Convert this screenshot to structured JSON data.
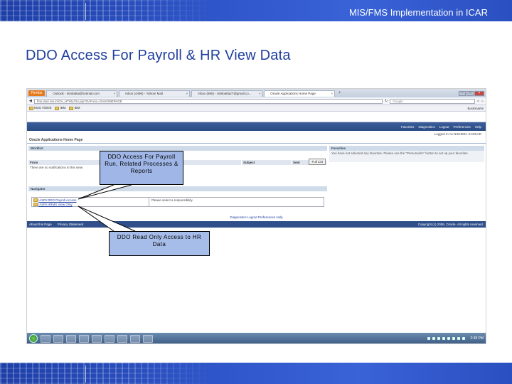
{
  "slide": {
    "header": "MIS/FMS Implementation in ICAR",
    "title": "DDO Access For Payroll & HR View Data"
  },
  "browser": {
    "firefox_label": "Firefox",
    "tabs": [
      {
        "label": "Outlook - ntinbatta@hotmail.com",
        "active": false
      },
      {
        "label": "Inbox (4496) - Yahoo! Mail",
        "active": false
      },
      {
        "label": "Inbox (865) - nitinbatta27@gmail.co...",
        "active": false
      },
      {
        "label": "Oracle Applications Home Page",
        "active": true
      }
    ],
    "url": "fms.iasri.res.in/OA_HTML/OA.jsp?OAFunc=OAHOMEPAGE",
    "search_placeholder": "Google",
    "bookmarks": {
      "items": [
        "Most Visited",
        "IBM",
        "IBM"
      ],
      "right": "Bookmarks"
    }
  },
  "oracle": {
    "global_links": [
      "Favorites",
      "Diagnostics",
      "Logout",
      "Preferences",
      "Help"
    ],
    "logged_in": "Logged In As NISHEEL SARKAR",
    "page_title": "Oracle Applications Home Page",
    "worklist": {
      "header": "Worklist",
      "full_list_button": "Full List",
      "columns": [
        "From",
        "Type",
        "Subject",
        "Sent"
      ],
      "empty_message": "There are no notifications in this view."
    },
    "favorites": {
      "header": "Favorites",
      "message": "You have not selected any favorites. Please use the \"Personalize\" button to set up your favorites."
    },
    "navigator": {
      "header": "Navigator",
      "responsibilities": [
        "IASRI DDO Payroll Access",
        "IASRI HRMS View Only"
      ],
      "message": "Please select a responsibility."
    },
    "footer_links": "Diagnostics  Logout  Preferences  Help",
    "footer_bar": {
      "left": [
        "About this Page",
        "Privacy Statement"
      ],
      "copyright": "Copyright (c) 2006, Oracle. All rights reserved."
    }
  },
  "taskbar": {
    "clock": "2:38 PM"
  },
  "callouts": {
    "payroll": "DDO Access For Payroll Run, Related Processes & Reports",
    "hr": "DDO Read Only Access to HR Data"
  }
}
